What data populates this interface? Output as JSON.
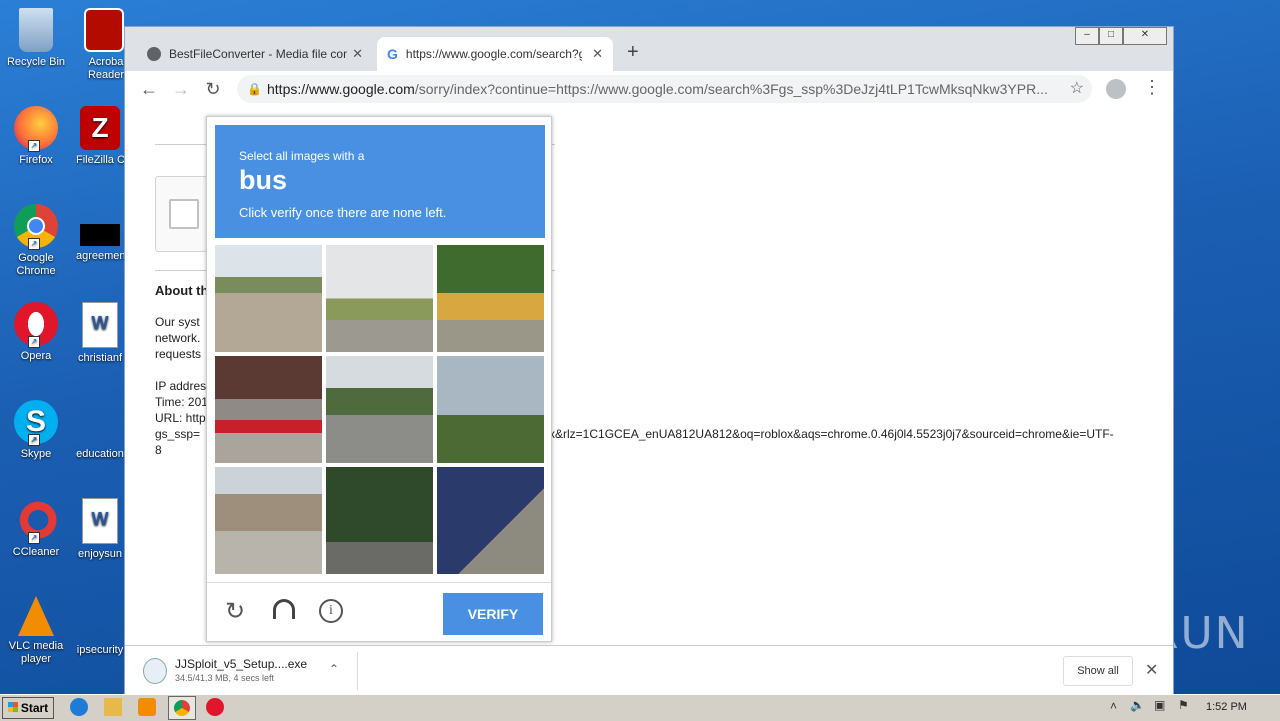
{
  "desktop": {
    "icons_left": [
      {
        "label": "Recycle Bin",
        "icon": "recycle-bin-icon"
      },
      {
        "label": "Firefox",
        "icon": "firefox-icon"
      },
      {
        "label": "Google Chrome",
        "icon": "chrome-icon"
      },
      {
        "label": "Opera",
        "icon": "opera-icon"
      },
      {
        "label": "Skype",
        "icon": "skype-icon"
      },
      {
        "label": "CCleaner",
        "icon": "ccleaner-icon"
      },
      {
        "label": "VLC media player",
        "icon": "vlc-icon"
      }
    ],
    "icons_right": [
      {
        "label": "Acroba Reader",
        "icon": "acrobat-icon"
      },
      {
        "label": "FileZilla C",
        "icon": "filezilla-icon"
      },
      {
        "label": "agreemen",
        "icon": "file-icon"
      },
      {
        "label": "christianf",
        "icon": "word-doc-icon"
      },
      {
        "label": "education",
        "icon": "file-icon"
      },
      {
        "label": "enjoysun",
        "icon": "word-doc-icon"
      },
      {
        "label": "ipsecurity",
        "icon": "file-icon"
      }
    ]
  },
  "browser": {
    "tabs": [
      {
        "title": "BestFileConverter - Media file conver",
        "icon": "globe-icon"
      },
      {
        "title": "https://www.google.com/search?gs_",
        "icon": "google-icon"
      }
    ],
    "url_host": "https://www.google.com",
    "url_rest": "/sorry/index?continue=https://www.google.com/search%3Fgs_ssp%3DeJzj4tLP1TcwMksqNkw3YPR...",
    "window_controls": [
      "‒",
      "□",
      "✕"
    ]
  },
  "page": {
    "heading": "About th",
    "para1": [
      "Our syst",
      "network.",
      "requests"
    ],
    "ip_lines": [
      "IP addres",
      "Time: 201",
      "URL: http",
      "gs_ssp="
    ],
    "url_tail": "x&rlz=1C1GCEA_enUA812UA812&oq=roblox&aqs=chrome.0.46j0l4.5523j0j7&sourceid=chrome&ie=UTF-",
    "url_tail2": "8"
  },
  "captcha": {
    "instruction": "Select all images with a",
    "target": "bus",
    "sub": "Click verify once there are none left.",
    "verify_label": "VERIFY"
  },
  "download": {
    "filename": "JJSploit_v5_Setup....exe",
    "status": "34.5/41.3 MB, 4 secs left",
    "show_all": "Show all"
  },
  "taskbar": {
    "start_label": "Start",
    "clock": "1:52 PM"
  },
  "watermark": "ANY RUN",
  "colors": {
    "captcha_blue": "#4a90e2",
    "desktop_blue": "#1b5fb3"
  }
}
